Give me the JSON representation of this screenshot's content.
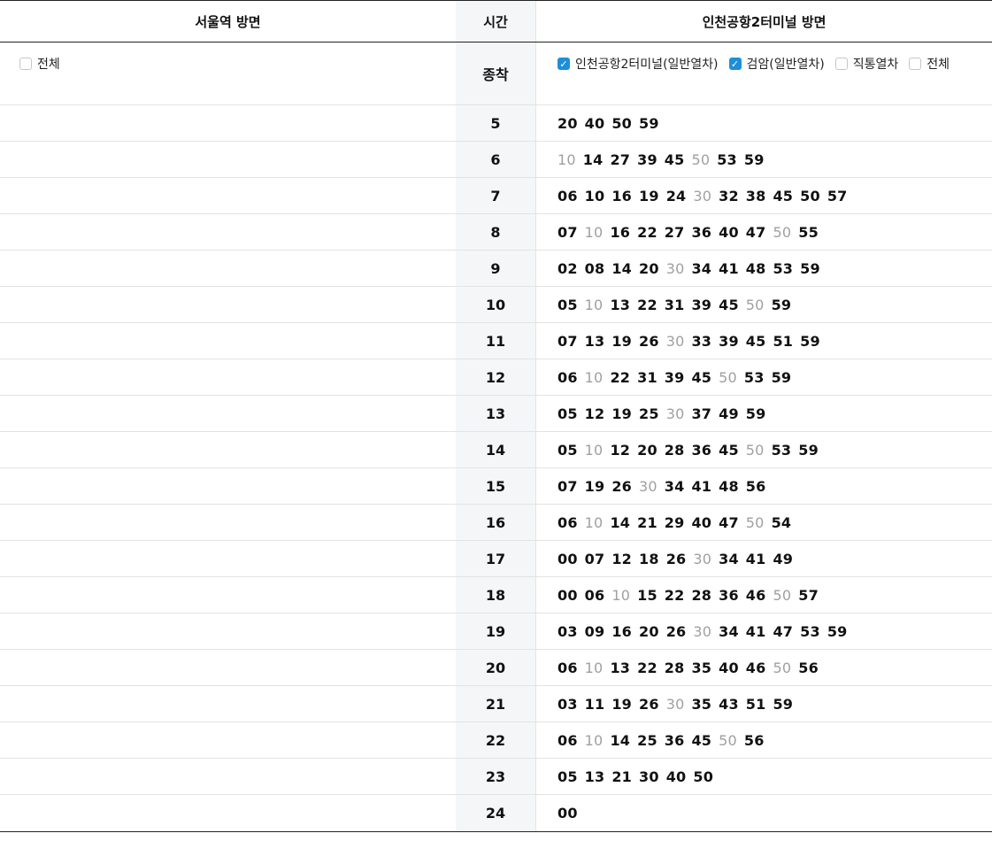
{
  "header": {
    "left_title": "서울역 방면",
    "mid_title": "시간",
    "right_title": "인천공항2터미널 방면"
  },
  "filters": {
    "left": [
      {
        "label": "전체",
        "checked": false
      }
    ],
    "mid_label": "종착",
    "right": [
      {
        "label": "인천공항2터미널(일반열차)",
        "checked": true
      },
      {
        "label": "검암(일반열차)",
        "checked": true
      },
      {
        "label": "직통열차",
        "checked": false
      },
      {
        "label": "전체",
        "checked": false
      }
    ]
  },
  "colors": {
    "accent": "#1e8fd6",
    "dim": "#a0a0a0"
  },
  "rows": [
    {
      "hour": "5",
      "minutes": [
        [
          "20",
          0
        ],
        [
          "40",
          0
        ],
        [
          "50",
          0
        ],
        [
          "59",
          0
        ]
      ]
    },
    {
      "hour": "6",
      "minutes": [
        [
          "10",
          1
        ],
        [
          "14",
          0
        ],
        [
          "27",
          0
        ],
        [
          "39",
          0
        ],
        [
          "45",
          0
        ],
        [
          "50",
          1
        ],
        [
          "53",
          0
        ],
        [
          "59",
          0
        ]
      ]
    },
    {
      "hour": "7",
      "minutes": [
        [
          "06",
          0
        ],
        [
          "10",
          0
        ],
        [
          "16",
          0
        ],
        [
          "19",
          0
        ],
        [
          "24",
          0
        ],
        [
          "30",
          1
        ],
        [
          "32",
          0
        ],
        [
          "38",
          0
        ],
        [
          "45",
          0
        ],
        [
          "50",
          0
        ],
        [
          "57",
          0
        ]
      ]
    },
    {
      "hour": "8",
      "minutes": [
        [
          "07",
          0
        ],
        [
          "10",
          1
        ],
        [
          "16",
          0
        ],
        [
          "22",
          0
        ],
        [
          "27",
          0
        ],
        [
          "36",
          0
        ],
        [
          "40",
          0
        ],
        [
          "47",
          0
        ],
        [
          "50",
          1
        ],
        [
          "55",
          0
        ]
      ]
    },
    {
      "hour": "9",
      "minutes": [
        [
          "02",
          0
        ],
        [
          "08",
          0
        ],
        [
          "14",
          0
        ],
        [
          "20",
          0
        ],
        [
          "30",
          1
        ],
        [
          "34",
          0
        ],
        [
          "41",
          0
        ],
        [
          "48",
          0
        ],
        [
          "53",
          0
        ],
        [
          "59",
          0
        ]
      ]
    },
    {
      "hour": "10",
      "minutes": [
        [
          "05",
          0
        ],
        [
          "10",
          1
        ],
        [
          "13",
          0
        ],
        [
          "22",
          0
        ],
        [
          "31",
          0
        ],
        [
          "39",
          0
        ],
        [
          "45",
          0
        ],
        [
          "50",
          1
        ],
        [
          "59",
          0
        ]
      ]
    },
    {
      "hour": "11",
      "minutes": [
        [
          "07",
          0
        ],
        [
          "13",
          0
        ],
        [
          "19",
          0
        ],
        [
          "26",
          0
        ],
        [
          "30",
          1
        ],
        [
          "33",
          0
        ],
        [
          "39",
          0
        ],
        [
          "45",
          0
        ],
        [
          "51",
          0
        ],
        [
          "59",
          0
        ]
      ]
    },
    {
      "hour": "12",
      "minutes": [
        [
          "06",
          0
        ],
        [
          "10",
          1
        ],
        [
          "22",
          0
        ],
        [
          "31",
          0
        ],
        [
          "39",
          0
        ],
        [
          "45",
          0
        ],
        [
          "50",
          1
        ],
        [
          "53",
          0
        ],
        [
          "59",
          0
        ]
      ]
    },
    {
      "hour": "13",
      "minutes": [
        [
          "05",
          0
        ],
        [
          "12",
          0
        ],
        [
          "19",
          0
        ],
        [
          "25",
          0
        ],
        [
          "30",
          1
        ],
        [
          "37",
          0
        ],
        [
          "49",
          0
        ],
        [
          "59",
          0
        ]
      ]
    },
    {
      "hour": "14",
      "minutes": [
        [
          "05",
          0
        ],
        [
          "10",
          1
        ],
        [
          "12",
          0
        ],
        [
          "20",
          0
        ],
        [
          "28",
          0
        ],
        [
          "36",
          0
        ],
        [
          "45",
          0
        ],
        [
          "50",
          1
        ],
        [
          "53",
          0
        ],
        [
          "59",
          0
        ]
      ]
    },
    {
      "hour": "15",
      "minutes": [
        [
          "07",
          0
        ],
        [
          "19",
          0
        ],
        [
          "26",
          0
        ],
        [
          "30",
          1
        ],
        [
          "34",
          0
        ],
        [
          "41",
          0
        ],
        [
          "48",
          0
        ],
        [
          "56",
          0
        ]
      ]
    },
    {
      "hour": "16",
      "minutes": [
        [
          "06",
          0
        ],
        [
          "10",
          1
        ],
        [
          "14",
          0
        ],
        [
          "21",
          0
        ],
        [
          "29",
          0
        ],
        [
          "40",
          0
        ],
        [
          "47",
          0
        ],
        [
          "50",
          1
        ],
        [
          "54",
          0
        ]
      ]
    },
    {
      "hour": "17",
      "minutes": [
        [
          "00",
          0
        ],
        [
          "07",
          0
        ],
        [
          "12",
          0
        ],
        [
          "18",
          0
        ],
        [
          "26",
          0
        ],
        [
          "30",
          1
        ],
        [
          "34",
          0
        ],
        [
          "41",
          0
        ],
        [
          "49",
          0
        ]
      ]
    },
    {
      "hour": "18",
      "minutes": [
        [
          "00",
          0
        ],
        [
          "06",
          0
        ],
        [
          "10",
          1
        ],
        [
          "15",
          0
        ],
        [
          "22",
          0
        ],
        [
          "28",
          0
        ],
        [
          "36",
          0
        ],
        [
          "46",
          0
        ],
        [
          "50",
          1
        ],
        [
          "57",
          0
        ]
      ]
    },
    {
      "hour": "19",
      "minutes": [
        [
          "03",
          0
        ],
        [
          "09",
          0
        ],
        [
          "16",
          0
        ],
        [
          "20",
          0
        ],
        [
          "26",
          0
        ],
        [
          "30",
          1
        ],
        [
          "34",
          0
        ],
        [
          "41",
          0
        ],
        [
          "47",
          0
        ],
        [
          "53",
          0
        ],
        [
          "59",
          0
        ]
      ]
    },
    {
      "hour": "20",
      "minutes": [
        [
          "06",
          0
        ],
        [
          "10",
          1
        ],
        [
          "13",
          0
        ],
        [
          "22",
          0
        ],
        [
          "28",
          0
        ],
        [
          "35",
          0
        ],
        [
          "40",
          0
        ],
        [
          "46",
          0
        ],
        [
          "50",
          1
        ],
        [
          "56",
          0
        ]
      ]
    },
    {
      "hour": "21",
      "minutes": [
        [
          "03",
          0
        ],
        [
          "11",
          0
        ],
        [
          "19",
          0
        ],
        [
          "26",
          0
        ],
        [
          "30",
          1
        ],
        [
          "35",
          0
        ],
        [
          "43",
          0
        ],
        [
          "51",
          0
        ],
        [
          "59",
          0
        ]
      ]
    },
    {
      "hour": "22",
      "minutes": [
        [
          "06",
          0
        ],
        [
          "10",
          1
        ],
        [
          "14",
          0
        ],
        [
          "25",
          0
        ],
        [
          "36",
          0
        ],
        [
          "45",
          0
        ],
        [
          "50",
          1
        ],
        [
          "56",
          0
        ]
      ]
    },
    {
      "hour": "23",
      "minutes": [
        [
          "05",
          0
        ],
        [
          "13",
          0
        ],
        [
          "21",
          0
        ],
        [
          "30",
          0
        ],
        [
          "40",
          0
        ],
        [
          "50",
          0
        ]
      ]
    },
    {
      "hour": "24",
      "minutes": [
        [
          "00",
          0
        ]
      ]
    }
  ]
}
